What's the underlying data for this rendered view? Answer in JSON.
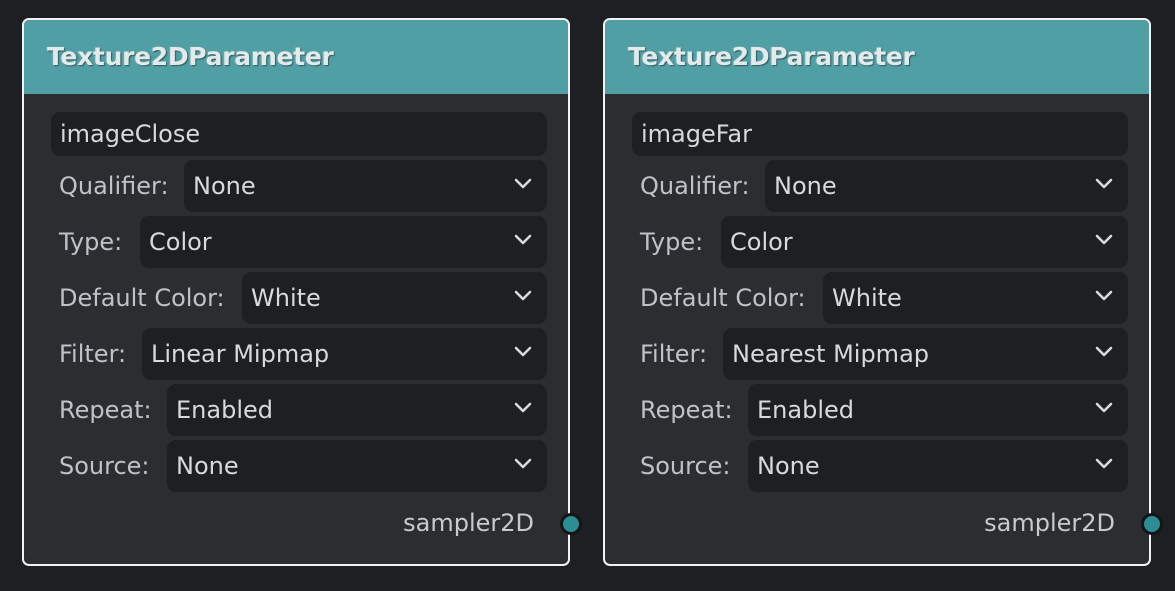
{
  "nodes": [
    {
      "title": "Texture2DParameter",
      "name": "imageClose",
      "fields": [
        {
          "label": "Qualifier:",
          "value": "None"
        },
        {
          "label": "Type:",
          "value": "Color"
        },
        {
          "label": "Default Color:",
          "value": "White"
        },
        {
          "label": "Filter:",
          "value": "Linear Mipmap"
        },
        {
          "label": "Repeat:",
          "value": "Enabled"
        },
        {
          "label": "Source:",
          "value": "None"
        }
      ],
      "output": "sampler2D"
    },
    {
      "title": "Texture2DParameter",
      "name": "imageFar",
      "fields": [
        {
          "label": "Qualifier:",
          "value": "None"
        },
        {
          "label": "Type:",
          "value": "Color"
        },
        {
          "label": "Default Color:",
          "value": "White"
        },
        {
          "label": "Filter:",
          "value": "Nearest Mipmap"
        },
        {
          "label": "Repeat:",
          "value": "Enabled"
        },
        {
          "label": "Source:",
          "value": "None"
        }
      ],
      "output": "sampler2D"
    }
  ],
  "colors": {
    "background": "#1d1f23",
    "node_body": "#2b2d31",
    "header": "#509fa5",
    "port": "#2d8d94",
    "node_border": "#f2f2f2"
  },
  "icons": {
    "dropdown": "chevron-down-icon",
    "output_port": "output-port-icon"
  }
}
